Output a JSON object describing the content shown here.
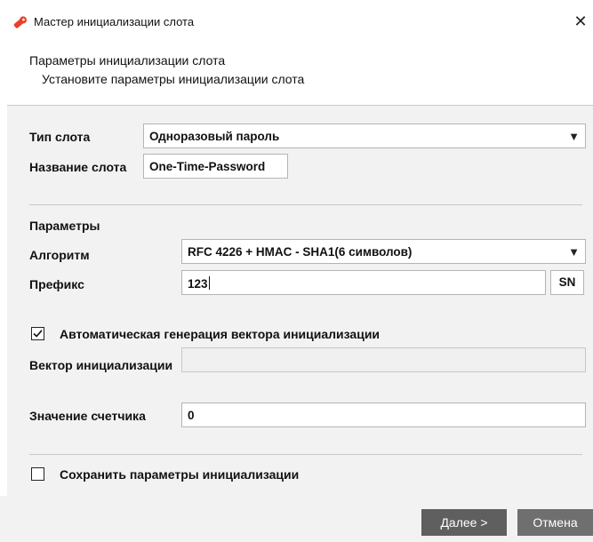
{
  "window": {
    "title": "Мастер инициализации слота",
    "close_glyph": "✕"
  },
  "header": {
    "title": "Параметры инициализации слота",
    "subtitle": "Установите параметры инициализации слота"
  },
  "slot": {
    "type_label": "Тип слота",
    "type_value": "Одноразовый пароль",
    "name_label": "Название слота",
    "name_value": "One-Time-Password"
  },
  "params": {
    "section_label": "Параметры",
    "algorithm_label": "Алгоритм",
    "algorithm_value": "RFC 4226 + HMAC - SHA1(6 символов)",
    "prefix_label": "Префикс",
    "prefix_value": "123",
    "sn_button": "SN"
  },
  "iv": {
    "auto_checkbox_label": "Автоматическая генерация вектора инициализации",
    "auto_checked": true,
    "vector_label": "Вектор инициализации",
    "vector_value": ""
  },
  "counter": {
    "label": "Значение счетчика",
    "value": "0"
  },
  "save": {
    "checkbox_label": "Сохранить параметры инициализации",
    "checked": false
  },
  "footer": {
    "next_button": "Далее >",
    "cancel_button": "Отмена"
  },
  "icons": {
    "app_icon": "key-icon",
    "dropdown": "chevron-down-icon"
  },
  "colors": {
    "accent": "#e8402a",
    "panel_bg": "#f2f2f2",
    "button_bg": "#6f6f6f"
  }
}
